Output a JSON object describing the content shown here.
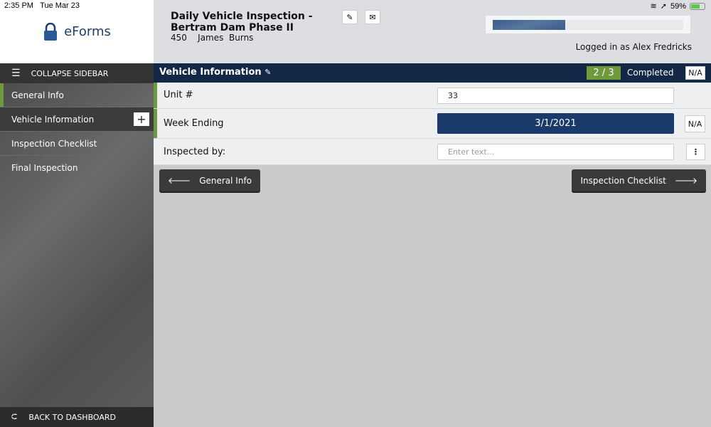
{
  "status": {
    "time": "2:35 PM",
    "date": "Tue Mar 23",
    "battery": "59%"
  },
  "logo": {
    "text": "eForms"
  },
  "header": {
    "title_line1": "Daily Vehicle Inspection -",
    "title_line2": "Bertram Dam Phase II",
    "subtitle": "450    James  Burns",
    "progress_percent": 38,
    "logged_in": "Logged in as Alex Fredricks"
  },
  "sidebar": {
    "collapse": "COLLAPSE SIDEBAR",
    "items": [
      {
        "label": "General Info"
      },
      {
        "label": "Vehicle Information"
      },
      {
        "label": "Inspection Checklist"
      },
      {
        "label": "Final Inspection"
      }
    ],
    "back": "BACK TO DASHBOARD"
  },
  "section": {
    "title": "Vehicle Information",
    "count": "2 / 3",
    "completed": "Completed",
    "na": "N/A"
  },
  "fields": {
    "unit_label": "Unit #",
    "unit_value": "33",
    "week_label": "Week Ending",
    "week_value": "3/1/2021",
    "week_na": "N/A",
    "inspected_label": "Inspected by:",
    "inspected_placeholder": "Enter text..."
  },
  "nav": {
    "prev": "General Info",
    "next": "Inspection Checklist"
  },
  "colors": {
    "navy": "#132746",
    "green": "#6e9a3c",
    "date_button": "#1a3a6c"
  }
}
